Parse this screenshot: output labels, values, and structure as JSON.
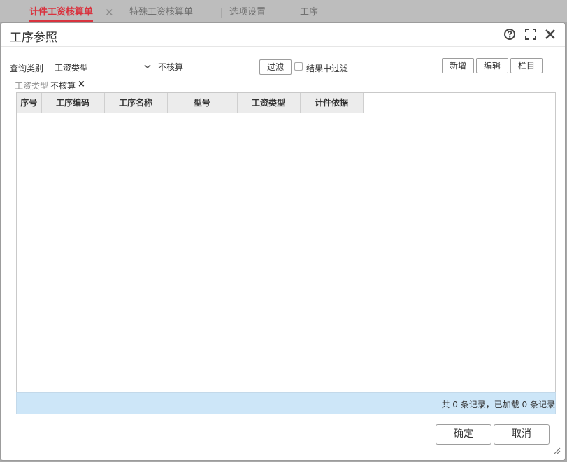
{
  "tabs": [
    {
      "label": "计件工资核算单"
    },
    {
      "label": "特殊工资核算单"
    },
    {
      "label": "选项设置"
    },
    {
      "label": "工序"
    }
  ],
  "dialog": {
    "title": "工序参照"
  },
  "filter": {
    "query_label": "查询类别",
    "category_value": "工资类型",
    "keyword_value": "不核算",
    "filter_button": "过滤",
    "filter_in_results_label": "结果中过滤",
    "filter_in_results_checked": false
  },
  "toolbar": {
    "add": "新增",
    "edit": "编辑",
    "columns": "栏目"
  },
  "active_filter": {
    "label": "工资类型",
    "value": "不核算"
  },
  "table": {
    "columns": [
      "序号",
      "工序编码",
      "工序名称",
      "型号",
      "工资类型",
      "计件依据"
    ],
    "rows": []
  },
  "status": {
    "text": "共 0 条记录，已加载 0 条记录"
  },
  "actions": {
    "ok": "确定",
    "cancel": "取消"
  }
}
